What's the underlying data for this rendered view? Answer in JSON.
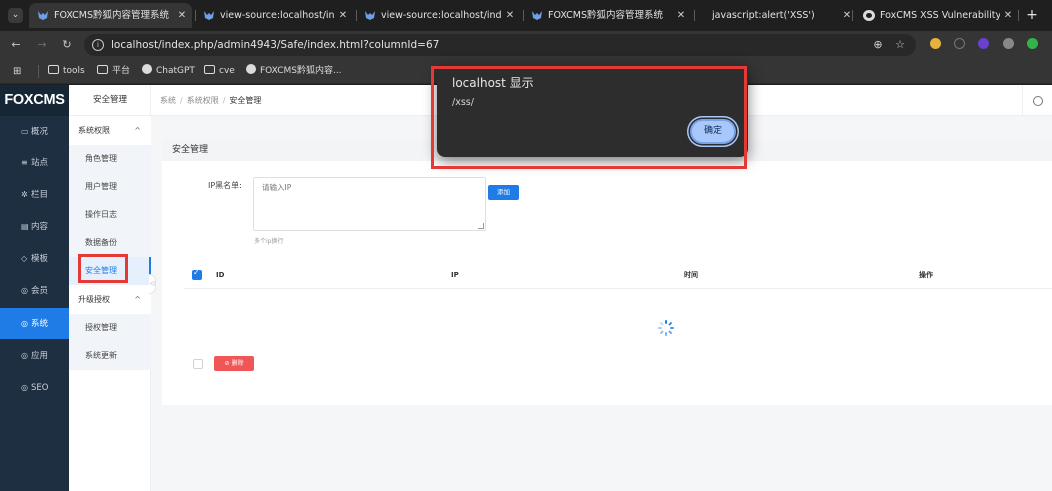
{
  "browser": {
    "tabs": [
      {
        "title": "FOXCMS黔狐内容管理系统",
        "favicon": "fox-icon"
      },
      {
        "title": "view-source:localhost/index.p",
        "favicon": "fox-icon"
      },
      {
        "title": "view-source:localhost/index.p",
        "favicon": "fox-icon"
      },
      {
        "title": "FOXCMS黔狐内容管理系统",
        "favicon": "fox-icon"
      },
      {
        "title": "javascript:alert('XSS')",
        "favicon": ""
      },
      {
        "title": "FoxCMS XSS Vulnerability",
        "favicon": "globe-icon"
      }
    ],
    "active_tab": 0,
    "url": "localhost/index.php/admin4943/Safe/index.html?columnId=67",
    "bookmarks": [
      {
        "label": "tools",
        "icon": "folder-icon"
      },
      {
        "label": "平台",
        "icon": "folder-icon"
      },
      {
        "label": "ChatGPT",
        "icon": "chatgpt-icon"
      },
      {
        "label": "cve",
        "icon": "folder-icon"
      },
      {
        "label": "FOXCMS黔狐内容...",
        "icon": "globe-icon"
      }
    ]
  },
  "app": {
    "logo": "FOXCMS",
    "sidebar": [
      {
        "label": "概况",
        "icon": "dashboard-icon"
      },
      {
        "label": "站点",
        "icon": "list-icon"
      },
      {
        "label": "栏目",
        "icon": "gear-icon"
      },
      {
        "label": "内容",
        "icon": "document-icon"
      },
      {
        "label": "模板",
        "icon": "template-icon"
      },
      {
        "label": "会员",
        "icon": "user-icon"
      },
      {
        "label": "系统",
        "icon": "system-icon"
      },
      {
        "label": "应用",
        "icon": "app-icon"
      },
      {
        "label": "SEO",
        "icon": "seo-icon"
      }
    ],
    "sidebar_active": 6,
    "subnav": {
      "heading": "安全管理",
      "groups": [
        {
          "label": "系统权限",
          "caret": "^",
          "items": [
            "角色管理",
            "用户管理",
            "操作日志",
            "数据备份",
            "安全管理"
          ]
        },
        {
          "label": "升级授权",
          "caret": "^",
          "items": [
            "授权管理",
            "系统更新"
          ]
        }
      ],
      "active_item": "安全管理"
    },
    "breadcrumb": [
      "系统",
      "系统权限",
      "安全管理"
    ],
    "panel": {
      "title": "安全管理",
      "ip_label": "IP黑名单:",
      "ip_placeholder": "请输入IP",
      "ip_hint": "多个ip换行",
      "add_button": "添加",
      "columns": [
        "ID",
        "IP",
        "时间",
        "操作"
      ],
      "delete_button": "⊘ 删除"
    }
  },
  "alert": {
    "title": "localhost 显示",
    "message": "/xss/",
    "ok": "确定"
  },
  "colors": {
    "accent": "#1f7ce6",
    "sidebar_bg": "#1e2f41",
    "danger": "#f05656",
    "highlight": "#e53935"
  }
}
